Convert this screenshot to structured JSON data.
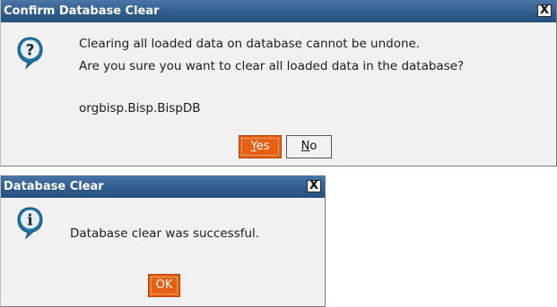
{
  "confirm_dialog": {
    "title": "Confirm Database Clear",
    "close_label": "X",
    "icon": "question-icon",
    "message_line1": "Clearing all loaded data on database cannot be undone.",
    "message_line2": "Are you sure you want to clear all loaded data in the database?",
    "detail": "orgbisp.Bisp.BispDB",
    "yes_mnemonic": "Y",
    "yes_rest": "es",
    "no_mnemonic": "N",
    "no_rest": "o"
  },
  "result_dialog": {
    "title": "Database Clear",
    "close_label": "X",
    "icon": "info-icon",
    "message": "Database clear was successful.",
    "ok_label": "OK"
  },
  "colors": {
    "titlebar": "#315f8f",
    "dialog_background": "#f1f1f1",
    "primary_button": "#e85e12",
    "icon_fill": "#1f73a6"
  }
}
